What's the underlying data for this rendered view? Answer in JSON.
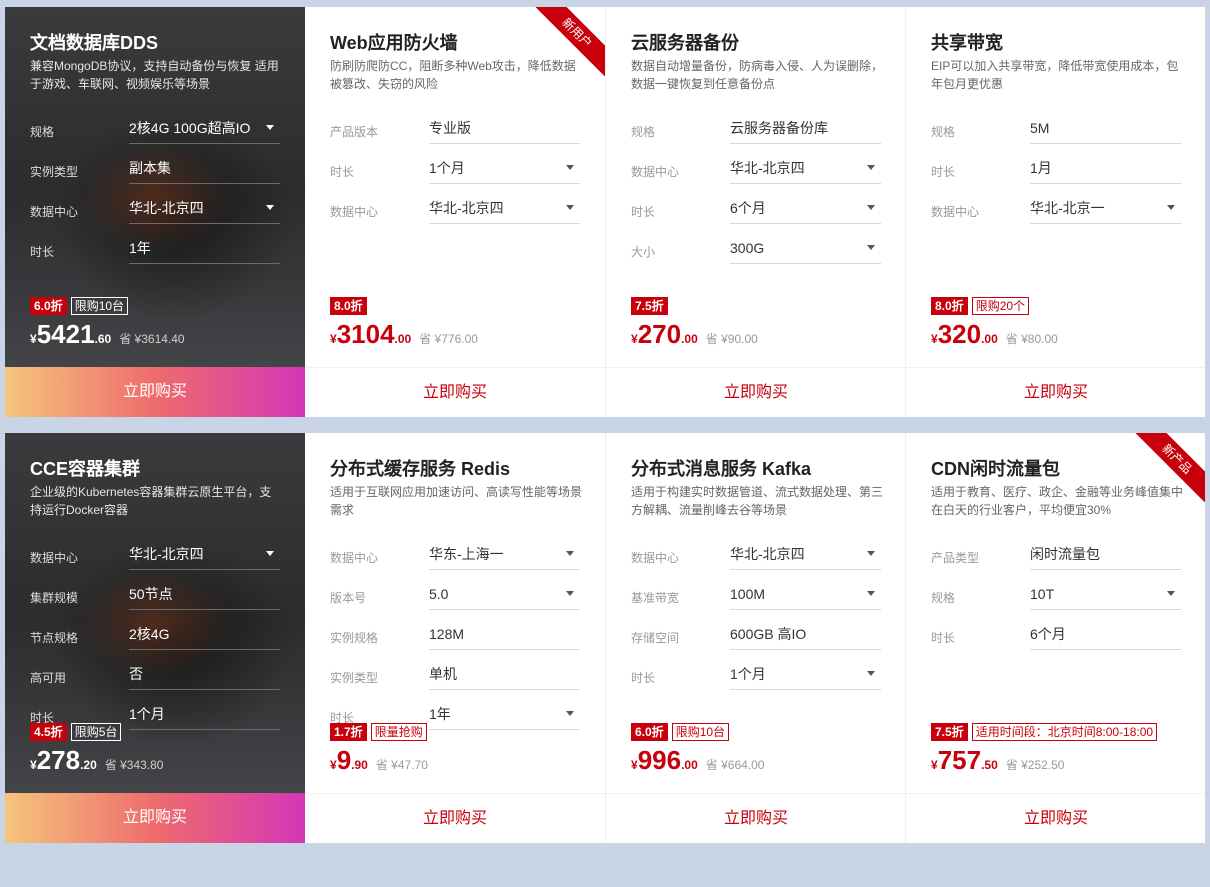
{
  "rows": [
    {
      "cards": [
        {
          "title": "文档数据库DDS",
          "desc": "兼容MongoDB协议，支持自动备份与恢复 适用于游戏、车联网、视频娱乐等场景",
          "fields": [
            {
              "label": "规格",
              "value": "2核4G 100G超高IO",
              "dropdown": true
            },
            {
              "label": "实例类型",
              "value": "副本集",
              "dropdown": false
            },
            {
              "label": "数据中心",
              "value": "华北-北京四",
              "dropdown": true
            },
            {
              "label": "时长",
              "value": "1年",
              "dropdown": false
            }
          ],
          "discount": "6.0折",
          "limit": "限购10台",
          "currency": "¥",
          "price_int": "5421",
          "price_dec": ".60",
          "save": "省 ¥3614.40",
          "buy": "立即购买"
        },
        {
          "title": "Web应用防火墙",
          "desc": "防刷防爬防CC，阻断多种Web攻击，降低数据被篡改、失窃的风险",
          "ribbon": "新用户",
          "fields": [
            {
              "label": "产品版本",
              "value": "专业版",
              "dropdown": false
            },
            {
              "label": "时长",
              "value": "1个月",
              "dropdown": true
            },
            {
              "label": "数据中心",
              "value": "华北-北京四",
              "dropdown": true
            }
          ],
          "discount": "8.0折",
          "limit": "",
          "currency": "¥",
          "price_int": "3104",
          "price_dec": ".00",
          "save": "省 ¥776.00",
          "buy": "立即购买"
        },
        {
          "title": "云服务器备份",
          "desc": "数据自动增量备份，防病毒入侵、人为误删除，数据一键恢复到任意备份点",
          "fields": [
            {
              "label": "规格",
              "value": "云服务器备份库",
              "dropdown": false
            },
            {
              "label": "数据中心",
              "value": "华北-北京四",
              "dropdown": true
            },
            {
              "label": "时长",
              "value": "6个月",
              "dropdown": true
            },
            {
              "label": "大小",
              "value": "300G",
              "dropdown": true
            }
          ],
          "discount": "7.5折",
          "limit": "",
          "currency": "¥",
          "price_int": "270",
          "price_dec": ".00",
          "save": "省 ¥90.00",
          "buy": "立即购买"
        },
        {
          "title": "共享带宽",
          "desc": "EIP可以加入共享带宽，降低带宽使用成本，包年包月更优惠",
          "fields": [
            {
              "label": "规格",
              "value": "5M",
              "dropdown": false
            },
            {
              "label": "时长",
              "value": "1月",
              "dropdown": false
            },
            {
              "label": "数据中心",
              "value": "华北-北京一",
              "dropdown": true
            }
          ],
          "discount": "8.0折",
          "limit": "限购20个",
          "currency": "¥",
          "price_int": "320",
          "price_dec": ".00",
          "save": "省 ¥80.00",
          "buy": "立即购买"
        }
      ]
    },
    {
      "cards": [
        {
          "title": "CCE容器集群",
          "desc": "企业级的Kubernetes容器集群云原生平台，支持运行Docker容器",
          "fields": [
            {
              "label": "数据中心",
              "value": "华北-北京四",
              "dropdown": true
            },
            {
              "label": "集群规模",
              "value": "50节点",
              "dropdown": false
            },
            {
              "label": "节点规格",
              "value": "2核4G",
              "dropdown": false
            },
            {
              "label": "高可用",
              "value": "否",
              "dropdown": false
            },
            {
              "label": "时长",
              "value": "1个月",
              "dropdown": false
            }
          ],
          "discount": "4.5折",
          "limit": "限购5台",
          "currency": "¥",
          "price_int": "278",
          "price_dec": ".20",
          "save": "省 ¥343.80",
          "buy": "立即购买"
        },
        {
          "title": "分布式缓存服务 Redis",
          "desc": "适用于互联网应用加速访问、高读写性能等场景需求",
          "fields": [
            {
              "label": "数据中心",
              "value": "华东-上海一",
              "dropdown": true
            },
            {
              "label": "版本号",
              "value": "5.0",
              "dropdown": true
            },
            {
              "label": "实例规格",
              "value": "128M",
              "dropdown": false
            },
            {
              "label": "实例类型",
              "value": "单机",
              "dropdown": false
            },
            {
              "label": "时长",
              "value": "1年",
              "dropdown": true
            }
          ],
          "discount": "1.7折",
          "limit": "限量抢购",
          "currency": "¥",
          "price_int": "9",
          "price_dec": ".90",
          "save": "省 ¥47.70",
          "buy": "立即购买"
        },
        {
          "title": "分布式消息服务 Kafka",
          "desc": "适用于构建实时数据管道、流式数据处理、第三方解耦、流量削峰去谷等场景",
          "fields": [
            {
              "label": "数据中心",
              "value": "华北-北京四",
              "dropdown": true
            },
            {
              "label": "基准带宽",
              "value": "100M",
              "dropdown": true
            },
            {
              "label": "存储空间",
              "value": "600GB 高IO",
              "dropdown": false
            },
            {
              "label": "时长",
              "value": "1个月",
              "dropdown": true
            }
          ],
          "discount": "6.0折",
          "limit": "限购10台",
          "currency": "¥",
          "price_int": "996",
          "price_dec": ".00",
          "save": "省 ¥664.00",
          "buy": "立即购买"
        },
        {
          "title": "CDN闲时流量包",
          "desc": "适用于教育、医疗、政企、金融等业务峰值集中在白天的行业客户，平均便宜30%",
          "ribbon": "新产品",
          "fields": [
            {
              "label": "产品类型",
              "value": "闲时流量包",
              "dropdown": false
            },
            {
              "label": "规格",
              "value": "10T",
              "dropdown": true
            },
            {
              "label": "时长",
              "value": "6个月",
              "dropdown": false
            }
          ],
          "discount": "7.5折",
          "limit": "适用时间段：北京时间8:00-18:00",
          "currency": "¥",
          "price_int": "757",
          "price_dec": ".50",
          "save": "省 ¥252.50",
          "buy": "立即购买"
        }
      ]
    }
  ]
}
